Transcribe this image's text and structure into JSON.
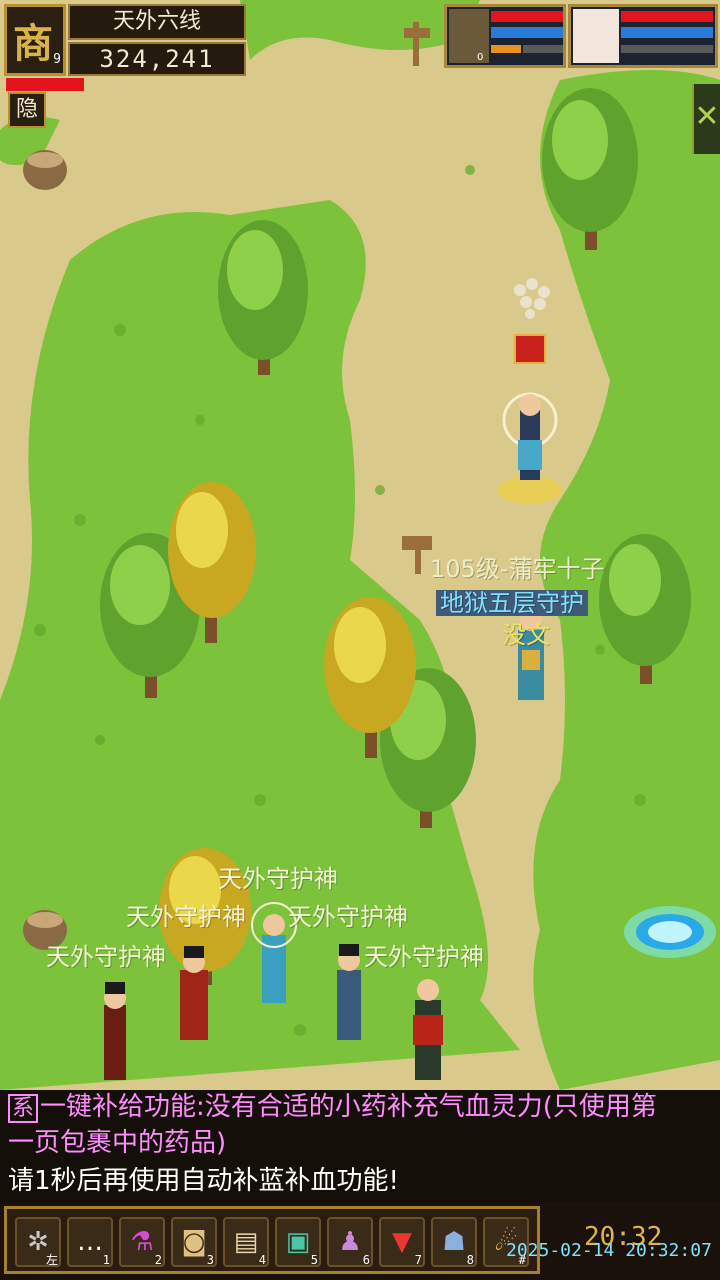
{
  "hud": {
    "portrait_glyph": "商",
    "level": "9",
    "server_name": "天外六线",
    "money": "324,241",
    "hide_label": "隐"
  },
  "party": {
    "member1_level": "0"
  },
  "world_labels": {
    "boss_title": "105级-蒲牢十子",
    "boss_guild": "地狱五层守护",
    "boss_name": "没文",
    "guardian1": "天外守护神",
    "guardian2": "天外守护神",
    "guardian3": "天外守护神",
    "guardian4": "天外守护神",
    "guardian5": "天外守护神"
  },
  "chat": {
    "tag": "系",
    "line1": "一键补给功能:没有合适的小药补充气血灵力(只使用第",
    "line2": "一页包裹中的药品)",
    "line3": "请1秒后再使用自动补蓝补血功能!"
  },
  "skillbar": {
    "slots": [
      {
        "icon": "settings-gear-icon",
        "glyph": "✲",
        "key": "左"
      },
      {
        "icon": "chat-bubble-icon",
        "glyph": "…",
        "key": "1"
      },
      {
        "icon": "potion-icon",
        "glyph": "⚗",
        "key": "2"
      },
      {
        "icon": "bag-icon",
        "glyph": "◙",
        "key": "3"
      },
      {
        "icon": "scroll-map-icon",
        "glyph": "▤",
        "key": "4"
      },
      {
        "icon": "card-icon",
        "glyph": "▣",
        "key": "5"
      },
      {
        "icon": "team-icon",
        "glyph": "♟",
        "key": "6"
      },
      {
        "icon": "flag-icon",
        "glyph": "▼",
        "key": "7"
      },
      {
        "icon": "friends-icon",
        "glyph": "☗",
        "key": "8"
      },
      {
        "icon": "mount-icon",
        "glyph": "☄",
        "key": "#"
      }
    ],
    "clock": "20:32",
    "timestamp": "2025-02-14 20:32:07"
  },
  "colors": {
    "grass": "#7cc23a",
    "path": "#d9c98a",
    "hp": "#e4141c",
    "mp": "#2a7ad8"
  }
}
